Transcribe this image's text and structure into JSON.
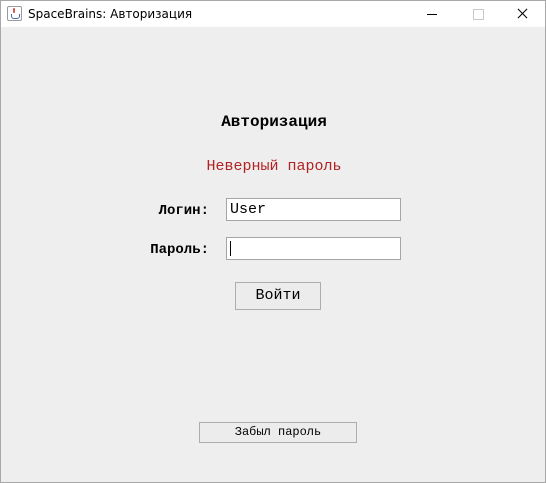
{
  "window": {
    "title": "SpaceBrains: Авторизация",
    "app_icon": "java-icon",
    "controls": [
      "minimize-icon",
      "maximize-icon",
      "close-icon"
    ]
  },
  "form": {
    "heading": "Авторизация",
    "error_message": "Неверный пароль",
    "login_label": "Логин:",
    "login_value": "User",
    "password_label": "Пароль:",
    "password_value": "",
    "submit_label": "Войти",
    "forgot_label": "Забыл пароль"
  },
  "colors": {
    "error": "#b22222",
    "background": "#eeeeee"
  }
}
